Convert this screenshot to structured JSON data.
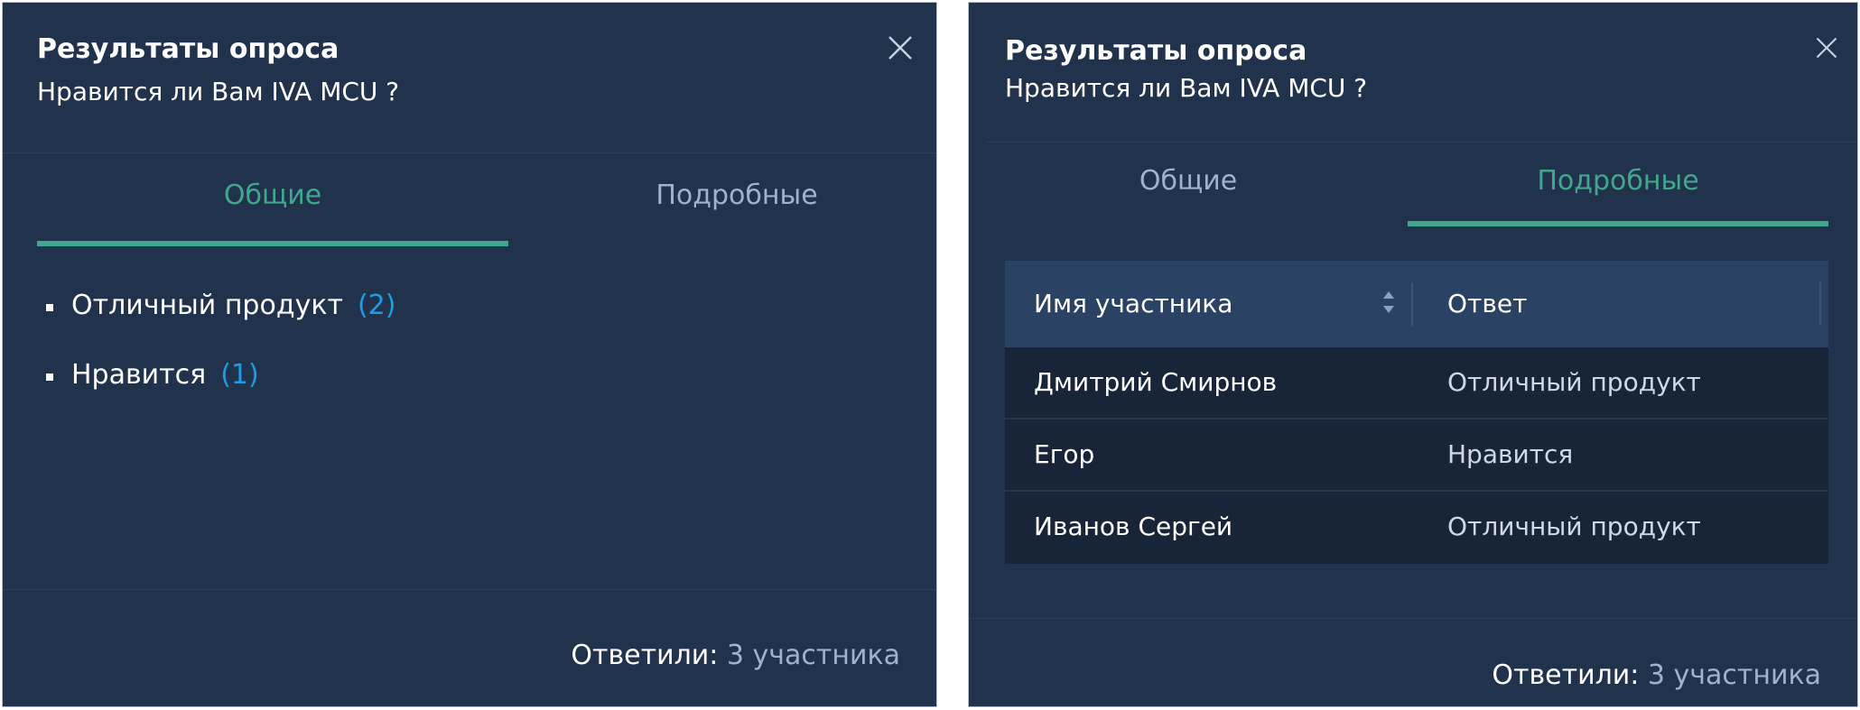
{
  "left_panel": {
    "title": "Результаты опроса",
    "question": "Нравится ли Вам IVA MCU ?",
    "tabs": [
      {
        "label": "Общие",
        "active": true
      },
      {
        "label": "Подробные",
        "active": false
      }
    ],
    "results": [
      {
        "option": "Отличный продукт",
        "count": "(2)"
      },
      {
        "option": "Нравится",
        "count": "(1)"
      }
    ],
    "footer": {
      "label": "Ответили:",
      "value": "3 участника"
    }
  },
  "right_panel": {
    "title": "Результаты опроса",
    "question": "Нравится ли Вам IVA MCU ?",
    "tabs": [
      {
        "label": "Общие",
        "active": false
      },
      {
        "label": "Подробные",
        "active": true
      }
    ],
    "table": {
      "columns": [
        "Имя участника",
        "Ответ"
      ],
      "rows": [
        {
          "name": "Дмитрий Смирнов",
          "answer": "Отличный продукт"
        },
        {
          "name": "Егор",
          "answer": "Нравится"
        },
        {
          "name": "Иванов Сергей",
          "answer": "Отличный продукт"
        }
      ]
    },
    "footer": {
      "label": "Ответили:",
      "value": "3 участника"
    }
  },
  "icons": {
    "close": "close-icon",
    "sort": "sort-icon",
    "bullet": "bullet-icon"
  },
  "colors": {
    "panel_background": "#21324c",
    "accent_green": "#41a88e",
    "count_blue": "#1e9ce6",
    "inactive_tab": "#9eb3cc",
    "table_header": "#2a4263",
    "table_row": "#182539"
  }
}
